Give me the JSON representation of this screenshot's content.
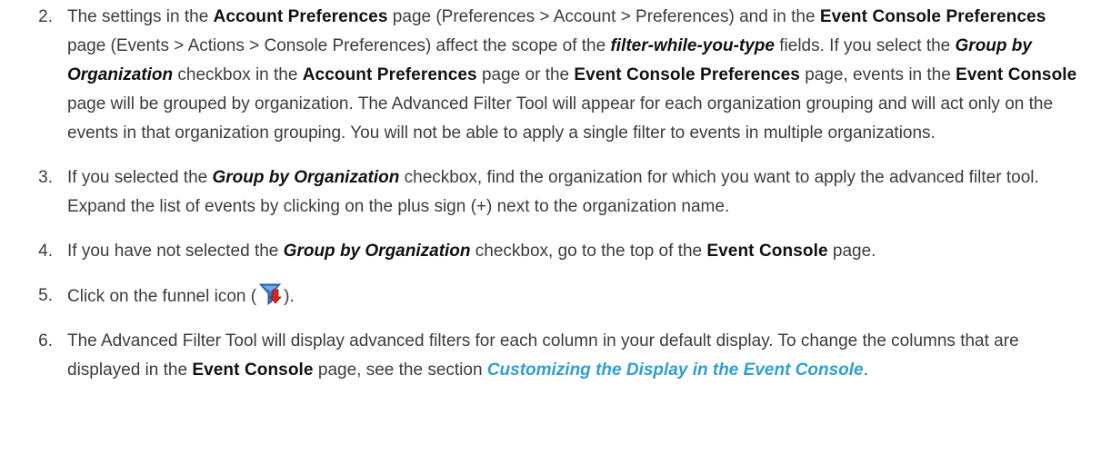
{
  "step2": {
    "num": "2.",
    "t1": "The settings in the ",
    "b1": "Account Preferences",
    "t2": " page (Preferences > Account > Preferences) and in the ",
    "b2": "Event Console Preferences",
    "t3": " page (Events > Actions > Console Preferences) affect the scope of the ",
    "e1": "filter-while-you-type",
    "t4": " fields. If you select the ",
    "e2": "Group by Organization",
    "t5": " checkbox in the ",
    "b3": "Account Preferences",
    "t6": " page or the ",
    "b4": "Event Console Preferences",
    "t7": " page, events in the ",
    "b5": "Event Console",
    "t8": " page will be grouped by organization. The Advanced Filter Tool will appear for each organization grouping and will act only on the events in that organization grouping. You will not be able to apply a single filter to events in multiple organizations."
  },
  "step3": {
    "num": "3.",
    "t1": "If you selected the ",
    "e1": "Group by Organization",
    "t2": " checkbox, find the organization for which you want to apply the advanced filter tool. Expand the list of events by clicking on the plus sign (+) next to the organization name."
  },
  "step4": {
    "num": "4.",
    "t1": "If you have not selected the ",
    "e1": "Group by Organization",
    "t2": " checkbox, go to the top of the ",
    "b1": "Event Console",
    "t3": " page."
  },
  "step5": {
    "num": "5.",
    "t1": "Click on the funnel icon (",
    "icon": "funnel-icon",
    "t2": ")."
  },
  "step6": {
    "num": "6.",
    "t1": "The Advanced Filter Tool will display advanced filters for each column in your default display. To change the columns that are displayed in the ",
    "b1": "Event Console",
    "t2": " page, see the section ",
    "link": "Customizing the Display in the Event Console",
    "t3": "."
  },
  "colors": {
    "link": "#2e9fd3",
    "text": "#3c3c3c",
    "funnel_blue": "#3a78c9",
    "funnel_red": "#d8231f"
  }
}
